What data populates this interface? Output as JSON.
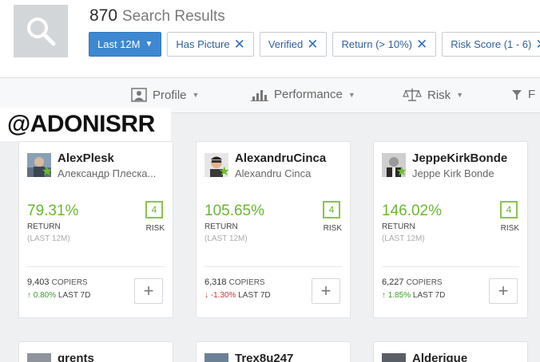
{
  "header": {
    "results_count": "870",
    "results_label": "Search Results",
    "filters": [
      {
        "label": "Last 12M",
        "primary": true
      },
      {
        "label": "Has Picture"
      },
      {
        "label": "Verified"
      },
      {
        "label": "Return (> 10%)"
      },
      {
        "label": "Risk Score (1 - 6)"
      }
    ]
  },
  "sortbar": {
    "profile": "Profile",
    "performance": "Performance",
    "risk": "Risk",
    "filter": "F"
  },
  "watermark": "@ADONISRR",
  "cards": [
    {
      "username": "AlexPlesk",
      "fullname": "Александр Плеска...",
      "return": "79.31%",
      "return_label": "RETURN",
      "period": "(LAST 12M)",
      "risk": "4",
      "risk_label": "RISK",
      "copiers": "9,403",
      "copiers_label": "COPIERS",
      "change": "0.80%",
      "change_dir": "up",
      "change_label": "LAST 7D"
    },
    {
      "username": "AlexandruCinca",
      "fullname": "Alexandru Cinca",
      "return": "105.65%",
      "return_label": "RETURN",
      "period": "(LAST 12M)",
      "risk": "4",
      "risk_label": "RISK",
      "copiers": "6,318",
      "copiers_label": "COPIERS",
      "change": "-1.30%",
      "change_dir": "down",
      "change_label": "LAST 7D"
    },
    {
      "username": "JeppeKirkBonde",
      "fullname": "Jeppe Kirk Bonde",
      "return": "146.02%",
      "return_label": "RETURN",
      "period": "(LAST 12M)",
      "risk": "4",
      "risk_label": "RISK",
      "copiers": "6,227",
      "copiers_label": "COPIERS",
      "change": "1.85%",
      "change_dir": "up",
      "change_label": "LAST 7D"
    }
  ],
  "partial_cards": [
    {
      "username": "grents"
    },
    {
      "username": "Trex8u247"
    },
    {
      "username": "Alderique"
    }
  ],
  "colors": {
    "accent": "#3d88d1",
    "positive": "#6cb633",
    "negative": "#d0343c"
  }
}
